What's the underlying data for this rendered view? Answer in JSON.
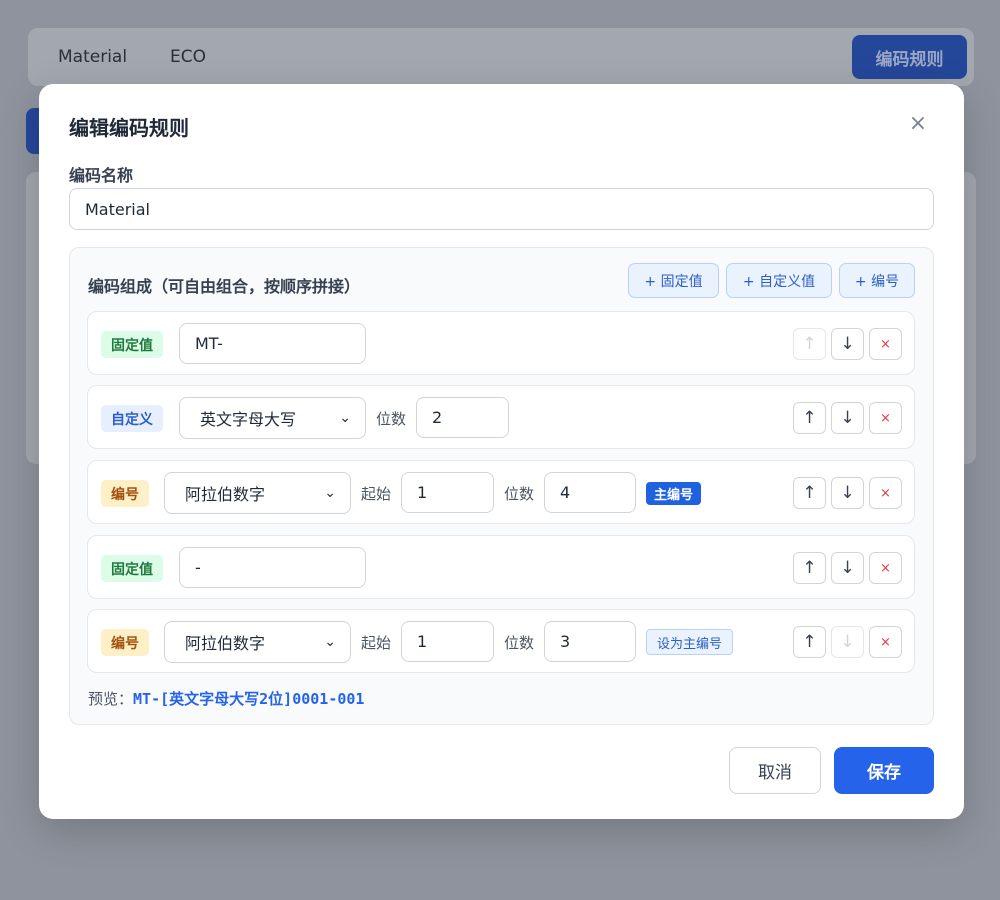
{
  "background": {
    "tabs": [
      "Material",
      "ECO"
    ],
    "primary_button": "编码规则"
  },
  "modal": {
    "title": "编辑编码规则",
    "close_icon": "×",
    "name_label": "编码名称",
    "name_value": "Material",
    "compose_title": "编码组成（可自由组合，按顺序拼接）",
    "add_buttons": [
      "+ 固定值",
      "+ 自定义值",
      "+ 编号"
    ],
    "segments": [
      {
        "type": "fixed",
        "tag": "固定值",
        "value": "MT-"
      },
      {
        "type": "custom",
        "tag": "自定义",
        "select": "英文字母大写",
        "digits_label": "位数",
        "digits": "2"
      },
      {
        "type": "serial",
        "tag": "编号",
        "select": "阿拉伯数字",
        "start_label": "起始",
        "start": "1",
        "digits_label": "位数",
        "digits": "4",
        "main_badge": "主编号"
      },
      {
        "type": "fixed",
        "tag": "固定值",
        "value": "-"
      },
      {
        "type": "serial",
        "tag": "编号",
        "select": "阿拉伯数字",
        "start_label": "起始",
        "start": "1",
        "digits_label": "位数",
        "digits": "3",
        "set_main_button": "设为主编号"
      }
    ],
    "controls": {
      "up": "↑",
      "down": "↓",
      "delete": "×"
    },
    "preview_label": "预览：",
    "preview_code": "MT-[英文字母大写2位]0001-001",
    "cancel_label": "取消",
    "save_label": "保存"
  }
}
